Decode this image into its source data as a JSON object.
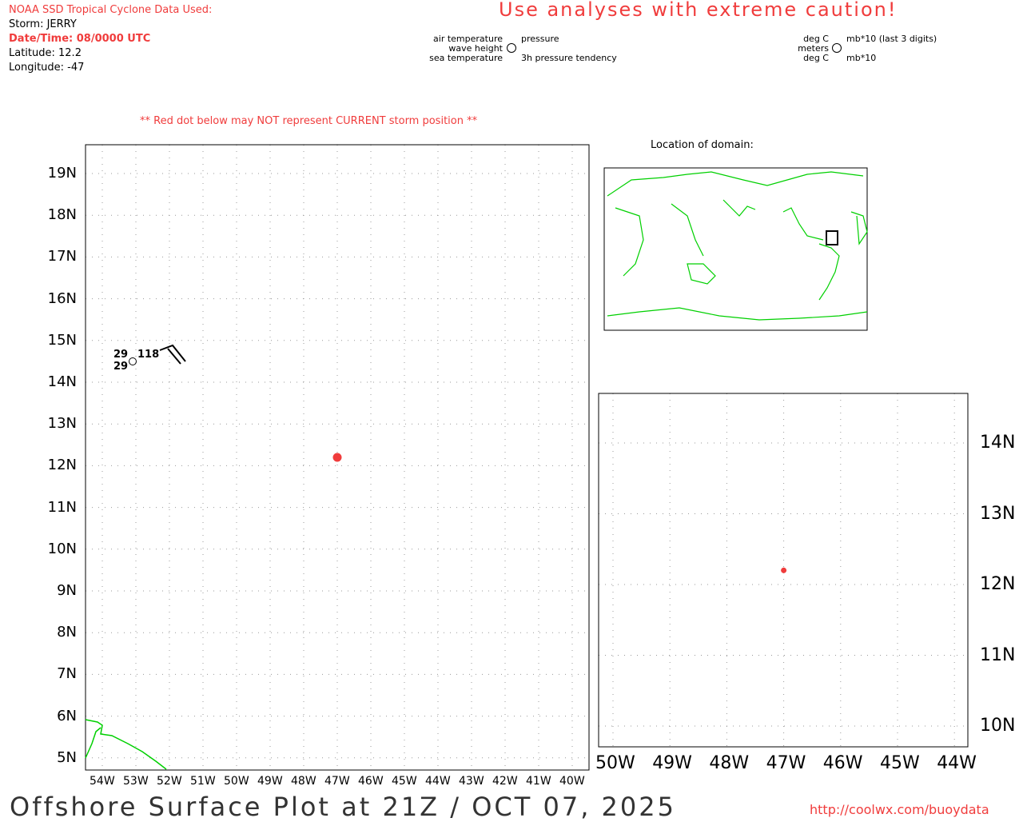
{
  "header": {
    "source": "NOAA SSD Tropical Cyclone Data Used:",
    "storm": "Storm: JERRY",
    "datetime": "Date/Time: 08/0000 UTC",
    "latitude": "Latitude: 12.2",
    "longitude": "Longitude: -47",
    "caution": "Use analyses with extreme caution!"
  },
  "legend": {
    "air": "air temperature",
    "wave": "wave height",
    "sea": "sea temperature",
    "pressure": "pressure",
    "tendency": "3h pressure tendency",
    "degc1": "deg C",
    "meters": "meters",
    "degc2": "deg C",
    "mb1": "mb*10 (last 3 digits)",
    "mb2": "mb*10"
  },
  "warning": "** Red dot below may NOT represent CURRENT storm position **",
  "inset_title": "Location of domain:",
  "main_map": {
    "lat_labels": [
      "19N",
      "18N",
      "17N",
      "16N",
      "15N",
      "14N",
      "13N",
      "12N",
      "11N",
      "10N",
      "9N",
      "8N",
      "7N",
      "6N",
      "5N"
    ],
    "lon_labels": [
      "54W",
      "53W",
      "52W",
      "51W",
      "50W",
      "49W",
      "48W",
      "47W",
      "46W",
      "45W",
      "44W",
      "43W",
      "42W",
      "41W",
      "40W"
    ],
    "storm": {
      "lat": 12.2,
      "lon": -47
    },
    "station": {
      "air": "29",
      "sea": "29",
      "pressure": "118"
    }
  },
  "zoom_map": {
    "lat_labels": [
      "14N",
      "13N",
      "12N",
      "11N",
      "10N"
    ],
    "lon_labels": [
      "50W",
      "49W",
      "48W",
      "47W",
      "46W",
      "45W",
      "44W"
    ],
    "storm": {
      "lat": 12.2,
      "lon": -47
    }
  },
  "colors": {
    "red": "#f03c3c",
    "land": "#00d000"
  },
  "footer": {
    "title": "Offshore Surface Plot at 21Z / OCT 07, 2025",
    "url": "http://coolwx.com/buoydata"
  }
}
